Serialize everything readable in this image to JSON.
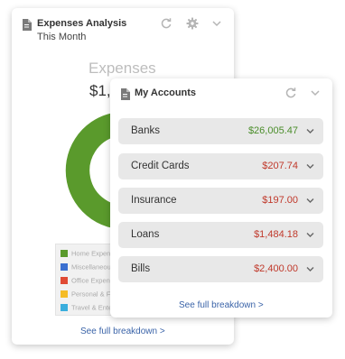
{
  "expenses_card": {
    "title": "Expenses Analysis",
    "subtitle": "This Month",
    "chart_title": "Expenses",
    "chart_total": "$1,",
    "link": "See full breakdown >",
    "icons": [
      "document-icon",
      "refresh-icon",
      "gear-icon",
      "chevron-down-icon"
    ]
  },
  "chart_data": {
    "type": "pie",
    "title": "Expenses",
    "categories": [
      "Home Expenses",
      "Miscellaneous",
      "Office Expenses",
      "Personal & Family",
      "Travel & Entertainment"
    ],
    "values": [
      28,
      6,
      6,
      7,
      10
    ],
    "colors": [
      "#5a9a2c",
      "#3a6fd0",
      "#e04a34",
      "#f5bc26",
      "#3aaedd"
    ],
    "legend_labels": [
      "Home Expen",
      "Miscellaneou",
      "Office Expen",
      "Personal & Fa",
      "Travel & Ente"
    ],
    "legend_position": "bottom"
  },
  "accounts_card": {
    "title": "My Accounts",
    "link": "See full breakdown >",
    "icons": [
      "document-icon",
      "refresh-icon",
      "chevron-down-icon"
    ],
    "rows": [
      {
        "label": "Banks",
        "amount": "$26,005.47",
        "color": "#4a8d2a"
      },
      {
        "label": "Credit Cards",
        "amount": "$207.74",
        "color": "#c0392b"
      },
      {
        "label": "Insurance",
        "amount": "$197.00",
        "color": "#c0392b"
      },
      {
        "label": "Loans",
        "amount": "$1,484.18",
        "color": "#c0392b"
      },
      {
        "label": "Bills",
        "amount": "$2,400.00",
        "color": "#c0392b"
      }
    ]
  }
}
